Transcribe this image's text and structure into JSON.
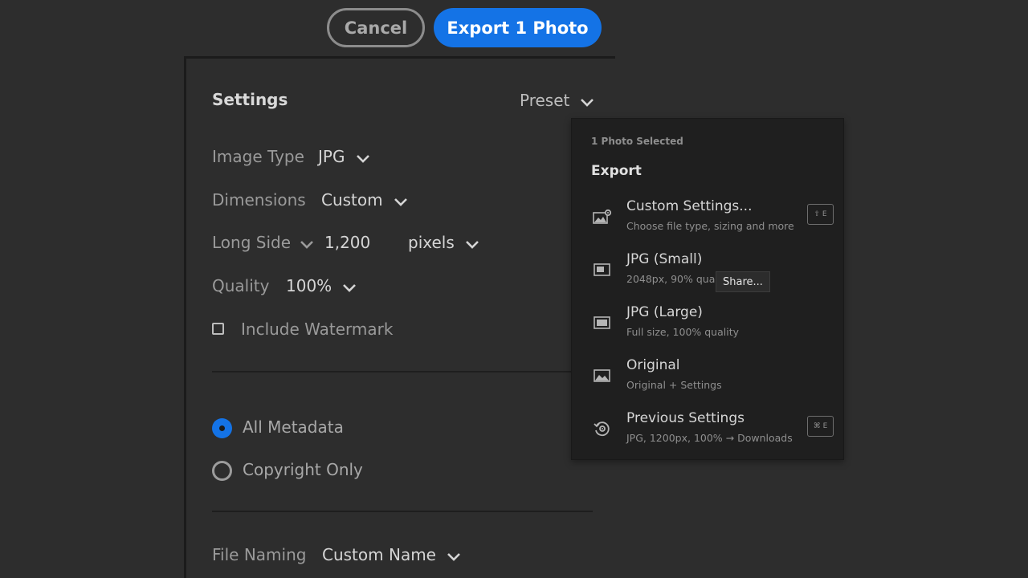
{
  "header": {
    "cancel_label": "Cancel",
    "export_label": "Export 1 Photo"
  },
  "settings": {
    "heading": "Settings",
    "preset_label": "Preset",
    "image_type_label": "Image Type",
    "image_type_value": "JPG",
    "dimensions_label": "Dimensions",
    "dimensions_value": "Custom",
    "long_side_label": "Long Side",
    "long_side_value": "1,200",
    "units_value": "pixels",
    "quality_label": "Quality",
    "quality_value": "100%",
    "watermark_label": "Include Watermark",
    "watermark_checked": false
  },
  "metadata": {
    "options": [
      {
        "label": "All Metadata",
        "selected": true
      },
      {
        "label": "Copyright Only",
        "selected": false
      }
    ]
  },
  "file_naming": {
    "label": "File Naming",
    "value": "Custom Name"
  },
  "menu": {
    "selection_info": "1 Photo Selected",
    "title": "Export",
    "items": [
      {
        "label": "Custom Settings...",
        "sub": "Choose file type, sizing and more",
        "icon": "image-gear-icon",
        "shortcut": "⇧ E"
      },
      {
        "label": "JPG (Small)",
        "sub": "2048px, 90% quality",
        "icon": "small-rectangle-icon"
      },
      {
        "label": "JPG (Large)",
        "sub": "Full size, 100% quality",
        "icon": "large-rectangle-icon"
      },
      {
        "label": "Original",
        "sub": "Original + Settings",
        "icon": "image-icon"
      },
      {
        "label": "Previous Settings",
        "sub": "JPG, 1200px, 100% → Downloads",
        "icon": "history-gear-icon",
        "shortcut": "⌘ E"
      }
    ]
  },
  "tooltip": {
    "text": "Share..."
  },
  "colors": {
    "accent": "#1473e6",
    "background": "#2d2d2d",
    "menu_background": "#1f1f1f"
  }
}
